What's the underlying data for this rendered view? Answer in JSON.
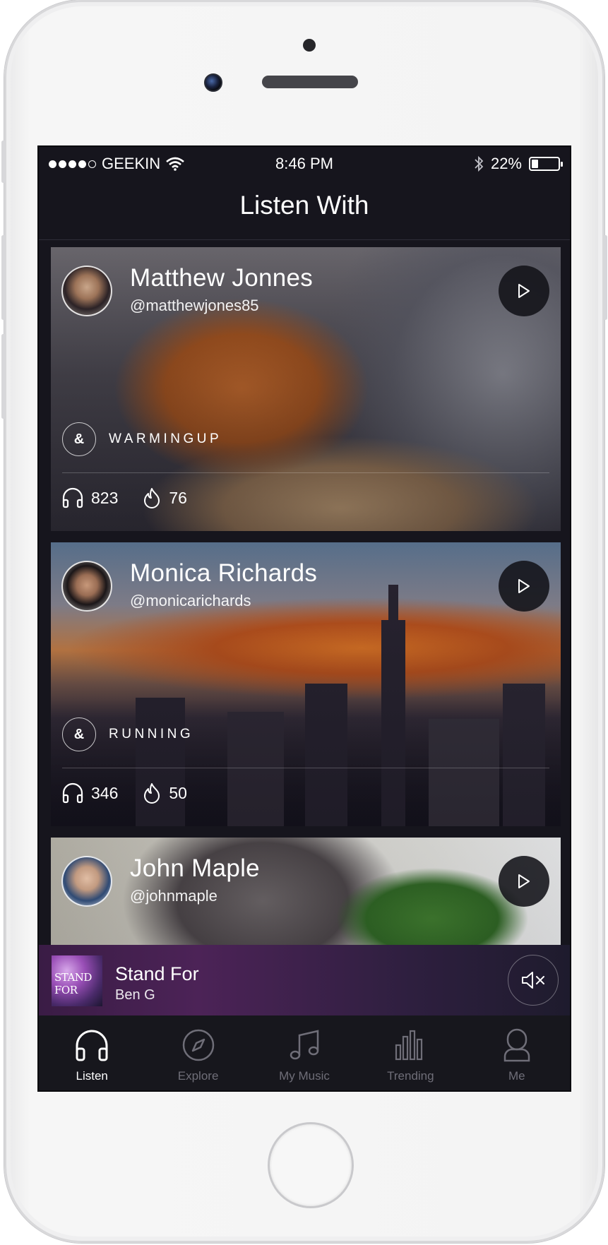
{
  "status_bar": {
    "carrier": "GEEKIN",
    "time": "8:46 PM",
    "battery_percent": "22%",
    "battery_level": 0.22,
    "signal_bars_filled": 4,
    "signal_bars_total": 5
  },
  "header": {
    "title": "Listen With"
  },
  "cards": [
    {
      "name": "Matthew Jonnes",
      "handle": "@matthewjones85",
      "tag_symbol": "&",
      "tag": "WARMINGUP",
      "listeners": "823",
      "likes": "76"
    },
    {
      "name": "Monica Richards",
      "handle": "@monicarichards",
      "tag_symbol": "&",
      "tag": "RUNNING",
      "listeners": "346",
      "likes": "50"
    },
    {
      "name": "John Maple",
      "handle": "@johnmaple"
    }
  ],
  "now_playing": {
    "title": "Stand For",
    "artist": "Ben G",
    "art_text": "STAND FOR"
  },
  "tabs": [
    {
      "label": "Listen",
      "icon": "headphones-icon",
      "active": true
    },
    {
      "label": "Explore",
      "icon": "compass-icon",
      "active": false
    },
    {
      "label": "My Music",
      "icon": "music-note-icon",
      "active": false
    },
    {
      "label": "Trending",
      "icon": "bar-chart-icon",
      "active": false
    },
    {
      "label": "Me",
      "icon": "person-icon",
      "active": false
    }
  ],
  "colors": {
    "screen_bg": "#16151d",
    "now_playing_accent": "#4c2357",
    "tab_active": "#ffffff",
    "tab_inactive": "#6f6e78"
  }
}
